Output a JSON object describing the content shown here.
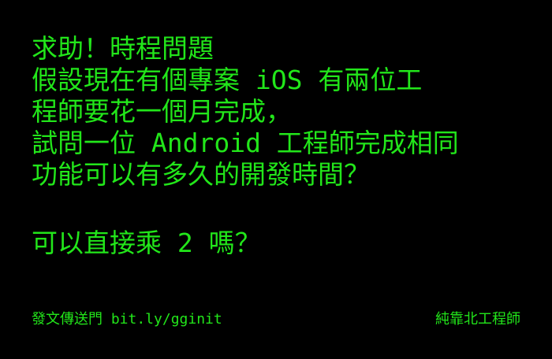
{
  "post": {
    "lines": [
      "求助！時程問題",
      "假設現在有個專案 iOS 有兩位工",
      "程師要花一個月完成，",
      "試問一位 Android 工程師完成相同",
      "功能可以有多久的開發時間？"
    ],
    "question": "可以直接乘 2 嗎？"
  },
  "footer": {
    "link_text": "發文傳送門 bit.ly/gginit",
    "author": "純靠北工程師"
  },
  "colors": {
    "background": "#000000",
    "text": "#22e61a"
  }
}
